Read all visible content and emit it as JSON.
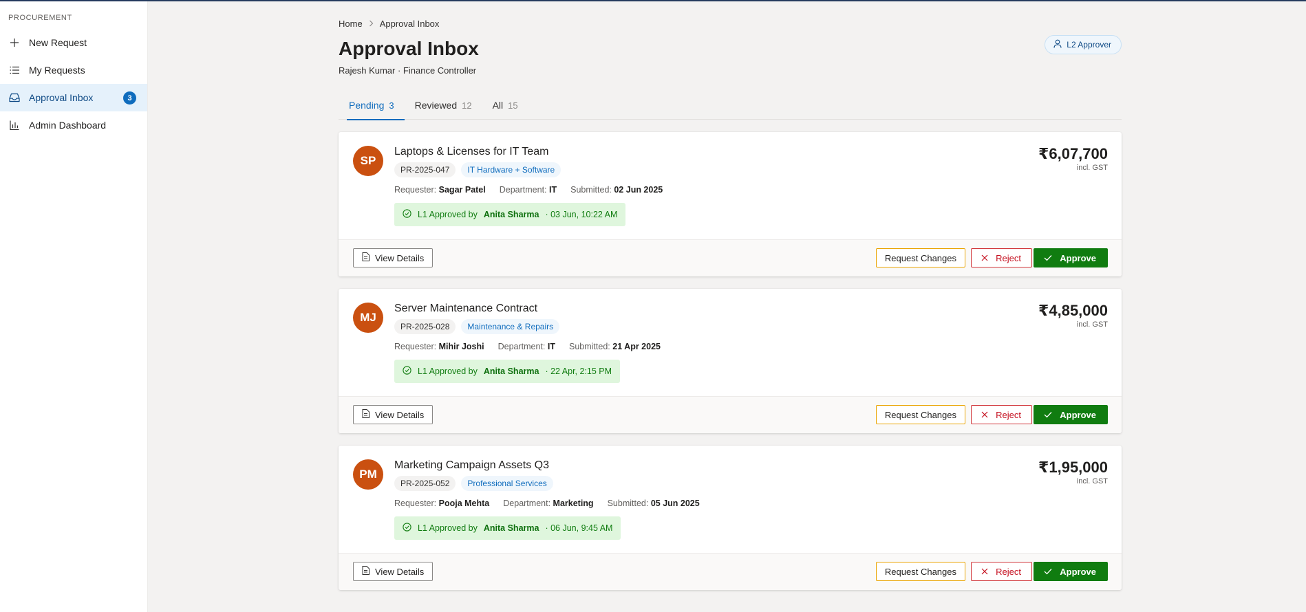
{
  "sidebar": {
    "section_title": "PROCUREMENT",
    "items": [
      {
        "label": "New Request",
        "icon": "plus-icon"
      },
      {
        "label": "My Requests",
        "icon": "list-icon"
      },
      {
        "label": "Approval Inbox",
        "icon": "inbox-icon",
        "badge": "3",
        "active": true
      },
      {
        "label": "Admin Dashboard",
        "icon": "bar-chart-icon"
      }
    ]
  },
  "header": {
    "breadcrumb": [
      "Home",
      "Approval Inbox"
    ],
    "title": "Approval Inbox",
    "subtitle": "Rajesh Kumar · Finance Controller",
    "role_badge": "L2 Approver"
  },
  "tabs": [
    {
      "label": "Pending",
      "count": "3",
      "active": true
    },
    {
      "label": "Reviewed",
      "count": "12"
    },
    {
      "label": "All",
      "count": "15"
    }
  ],
  "labels": {
    "requester": "Requester:",
    "department": "Department:",
    "submitted": "Submitted:",
    "approved_by": "L1 Approved by",
    "incl_gst": "incl. GST",
    "view_details": "View Details",
    "request_changes": "Request Changes",
    "reject": "Reject",
    "approve": "Approve"
  },
  "requests": [
    {
      "initials": "SP",
      "title": "Laptops & Licenses for IT Team",
      "id": "PR-2025-047",
      "category": "IT Hardware + Software",
      "requester": "Sagar Patel",
      "department": "IT",
      "submitted": "02 Jun 2025",
      "approver": "Anita Sharma",
      "approved_at": "· 03 Jun, 10:22 AM",
      "amount": "₹6,07,700"
    },
    {
      "initials": "MJ",
      "title": "Server Maintenance Contract",
      "id": "PR-2025-028",
      "category": "Maintenance & Repairs",
      "requester": "Mihir Joshi",
      "department": "IT",
      "submitted": "21 Apr 2025",
      "approver": "Anita Sharma",
      "approved_at": "· 22 Apr, 2:15 PM",
      "amount": "₹4,85,000"
    },
    {
      "initials": "PM",
      "title": "Marketing Campaign Assets Q3",
      "id": "PR-2025-052",
      "category": "Professional Services",
      "requester": "Pooja Mehta",
      "department": "Marketing",
      "submitted": "05 Jun 2025",
      "approver": "Anita Sharma",
      "approved_at": "· 06 Jun, 9:45 AM",
      "amount": "₹1,95,000"
    }
  ],
  "colors": {
    "accent": "#0f6cbd",
    "avatar": "#ca5010",
    "approve": "#107c10",
    "reject": "#d13438",
    "changes": "#eaa300",
    "approved_bg": "#dff6dd"
  }
}
